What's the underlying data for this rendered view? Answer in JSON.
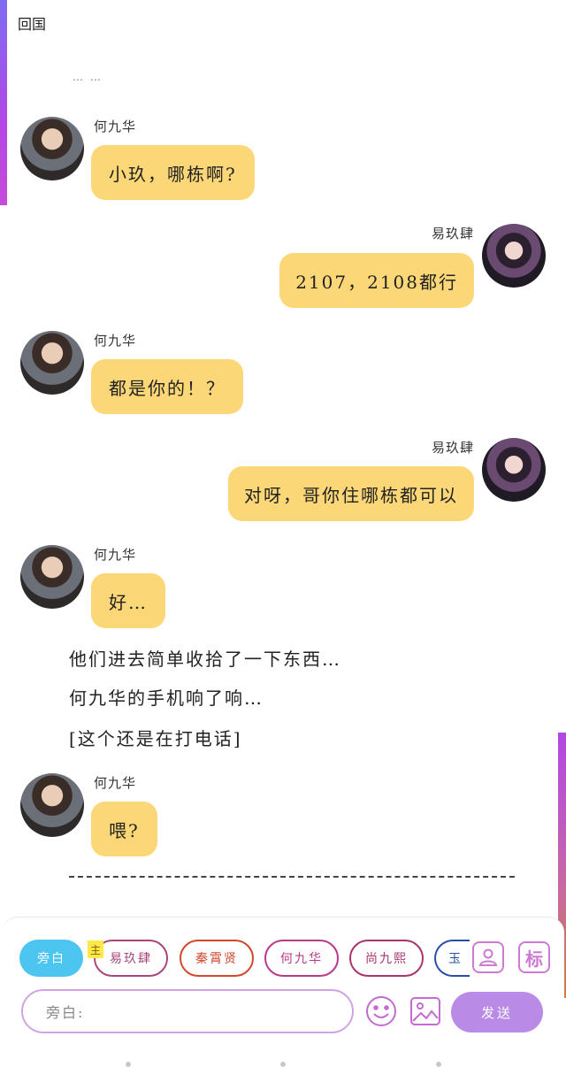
{
  "header": {
    "title": "回国",
    "ellipsis": "… …"
  },
  "messages": [
    {
      "speaker": "何九华",
      "text": "小玖，哪栋啊?",
      "side": "left",
      "avatar": "he-jiuhua-avatar"
    },
    {
      "speaker": "易玖肆",
      "text": "2107，2108都行",
      "side": "right",
      "avatar": "yi-jiusi-avatar"
    },
    {
      "speaker": "何九华",
      "text": "都是你的！？",
      "side": "left",
      "avatar": "he-jiuhua-avatar"
    },
    {
      "speaker": "易玖肆",
      "text": "对呀，哥你住哪栋都可以",
      "side": "right",
      "avatar": "yi-jiusi-avatar"
    },
    {
      "speaker": "何九华",
      "text": "好…",
      "side": "left",
      "avatar": "he-jiuhua-avatar"
    },
    {
      "speaker": "何九华",
      "text": "喂?",
      "side": "left",
      "avatar": "he-jiuhua-avatar"
    }
  ],
  "narration": [
    "他们进去简单收拾了一下东西…",
    "何九华的手机响了响…",
    "[这个还是在打电话]"
  ],
  "divider_text": "--------------------------------------------------------------------",
  "composer": {
    "narration_chip": "旁白",
    "main_badge": "主",
    "role_chips": [
      "易玖肆",
      "秦霄贤",
      "何九华",
      "尚九熙",
      "玉"
    ],
    "tag_icon_label": "标",
    "input_placeholder": "旁白:",
    "send_label": "发送"
  },
  "colors": {
    "bubble": "#fcd777",
    "narration_chip": "#4cc5f0",
    "send_button": "#b98be6",
    "accent": "#c56ad0"
  }
}
